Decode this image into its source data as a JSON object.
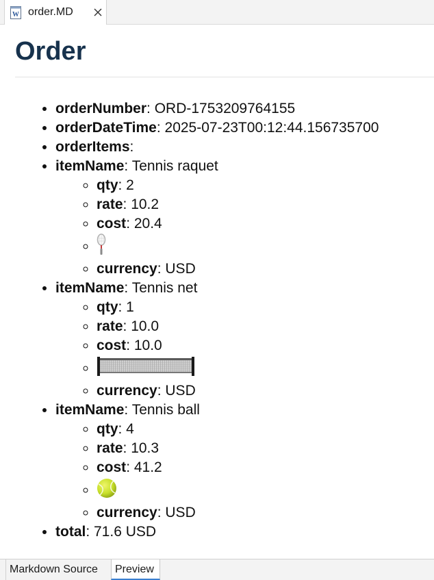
{
  "editor": {
    "tab_title": "order.MD",
    "file_icon": "word-document-icon",
    "close_icon": "close-icon"
  },
  "preview": {
    "title": "Order",
    "order_number": {
      "key": "orderNumber",
      "value": "ORD-1753209764155"
    },
    "order_date_time": {
      "key": "orderDateTime",
      "value": "2025-07-23T00:12:44.156735700"
    },
    "order_items_key": "orderItems",
    "items": [
      {
        "name_key": "itemName",
        "name": "Tennis raquet",
        "qty_key": "qty",
        "qty": "2",
        "rate_key": "rate",
        "rate": "10.2",
        "cost_key": "cost",
        "cost": "20.4",
        "image": "tennis-racket-icon",
        "currency_key": "currency",
        "currency": "USD"
      },
      {
        "name_key": "itemName",
        "name": "Tennis net",
        "qty_key": "qty",
        "qty": "1",
        "rate_key": "rate",
        "rate": "10.0",
        "cost_key": "cost",
        "cost": "10.0",
        "image": "tennis-net-icon",
        "currency_key": "currency",
        "currency": "USD"
      },
      {
        "name_key": "itemName",
        "name": "Tennis ball",
        "qty_key": "qty",
        "qty": "4",
        "rate_key": "rate",
        "rate": "10.3",
        "cost_key": "cost",
        "cost": "41.2",
        "image": "tennis-ball-icon",
        "currency_key": "currency",
        "currency": "USD"
      }
    ],
    "total": {
      "key": "total",
      "value": "71.6 USD"
    }
  },
  "bottom_tabs": {
    "source_label": "Markdown Source",
    "preview_label": "Preview"
  },
  "colors": {
    "title": "#17324d",
    "active_tab_underline": "#3b7fd0",
    "tennis_ball": "#c8e02a"
  }
}
